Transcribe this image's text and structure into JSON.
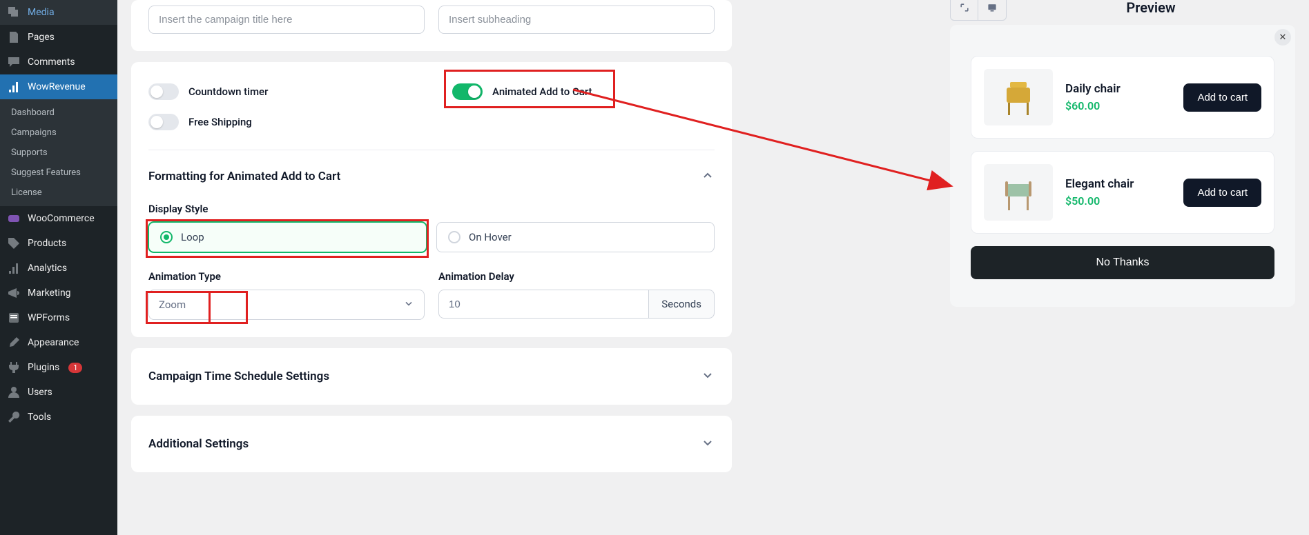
{
  "sidebar": {
    "menu": [
      {
        "icon": "media",
        "label": "Media"
      },
      {
        "icon": "page",
        "label": "Pages"
      },
      {
        "icon": "comment",
        "label": "Comments"
      },
      {
        "icon": "analytics",
        "label": "WowRevenue",
        "active": true,
        "sub": [
          {
            "label": "Dashboard"
          },
          {
            "label": "Campaigns"
          },
          {
            "label": "Supports"
          },
          {
            "label": "Suggest Features"
          },
          {
            "label": "License"
          }
        ]
      },
      {
        "icon": "woo",
        "label": "WooCommerce"
      },
      {
        "icon": "tag",
        "label": "Products"
      },
      {
        "icon": "analytics",
        "label": "Analytics"
      },
      {
        "icon": "megaphone",
        "label": "Marketing"
      },
      {
        "icon": "form",
        "label": "WPForms"
      },
      {
        "icon": "appearance",
        "label": "Appearance"
      },
      {
        "icon": "plugin",
        "label": "Plugins",
        "badge": "1"
      },
      {
        "icon": "user",
        "label": "Users"
      },
      {
        "icon": "tool",
        "label": "Tools"
      }
    ]
  },
  "form": {
    "title_ph": "Insert the campaign title here",
    "sub_ph": "Insert subheading",
    "toggles": {
      "countdown": "Countdown timer",
      "animated": "Animated Add to Cart",
      "freeship": "Free Shipping"
    },
    "section_format": "Formatting for Animated Add to Cart",
    "display_style_label": "Display Style",
    "display_opts": {
      "loop": "Loop",
      "hover": "On Hover"
    },
    "anim_type_label": "Animation Type",
    "anim_type_value": "Zoom",
    "anim_delay_label": "Animation Delay",
    "anim_delay_value": "10",
    "anim_delay_unit": "Seconds",
    "section_schedule": "Campaign Time Schedule Settings",
    "section_additional": "Additional Settings"
  },
  "preview": {
    "title": "Preview",
    "products": [
      {
        "name": "Daily chair",
        "price": "$60.00",
        "color": "#e3b843"
      },
      {
        "name": "Elegant chair",
        "price": "$50.00",
        "color": "#9dc2a7"
      }
    ],
    "add_btn": "Add to cart",
    "no_thanks": "No Thanks"
  }
}
